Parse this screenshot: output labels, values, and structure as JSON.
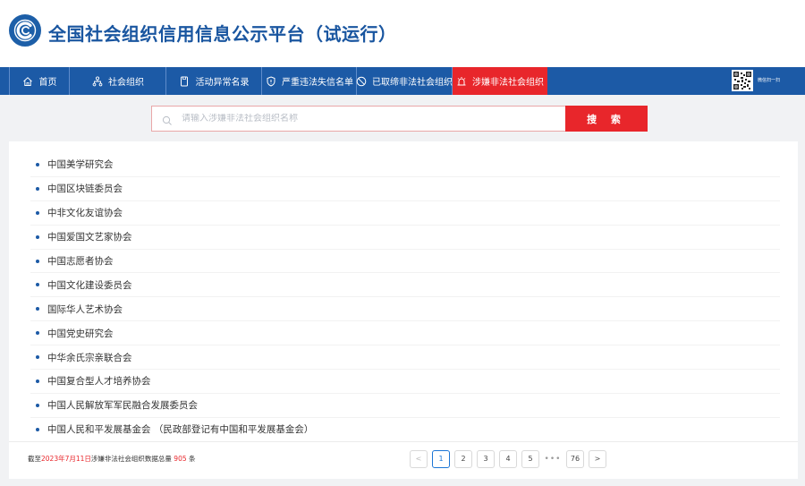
{
  "header": {
    "title": "全国社会组织信用信息公示平台（试运行）",
    "logo_icon": "platform-logo-icon"
  },
  "nav": {
    "items": [
      {
        "label": "首页",
        "icon": "home-icon"
      },
      {
        "label": "社会组织",
        "icon": "org-chart-icon"
      },
      {
        "label": "活动异常名录",
        "icon": "document-icon"
      },
      {
        "label": "严重违法失信名单",
        "icon": "shield-icon"
      },
      {
        "label": "已取缔非法社会组织",
        "icon": "ban-icon"
      },
      {
        "label": "涉嫌非法社会组织",
        "icon": "alarm-bell-icon"
      }
    ],
    "active_index": 5,
    "qr_label": "微信扫一扫",
    "bg_color": "#1c5aa6",
    "active_color": "#e8262b"
  },
  "search": {
    "placeholder": "请输入涉嫌非法社会组织名称",
    "value": "",
    "button_label": "搜 索"
  },
  "list": {
    "items": [
      "中国美学研究会",
      "中国区块链委员会",
      "中非文化友谊协会",
      "中国爱国文艺家协会",
      "中国志愿者协会",
      "中国文化建设委员会",
      "国际华人艺术协会",
      "中国党史研究会",
      "中华余氏宗亲联合会",
      "中国复合型人才培养协会",
      "中国人民解放军军民融合发展委员会",
      "中国人民和平发展基金会 （民政部登记有中国和平发展基金会）"
    ]
  },
  "footer": {
    "prefix": "截至",
    "date": "2023年7月11日",
    "middle": "涉嫌非法社会组织数据总量",
    "total": "905",
    "suffix": "条"
  },
  "pagination": {
    "prev": "<",
    "pages": [
      "1",
      "2",
      "3",
      "4",
      "5"
    ],
    "ellipsis": "•••",
    "last": "76",
    "next": ">",
    "current": "1"
  }
}
